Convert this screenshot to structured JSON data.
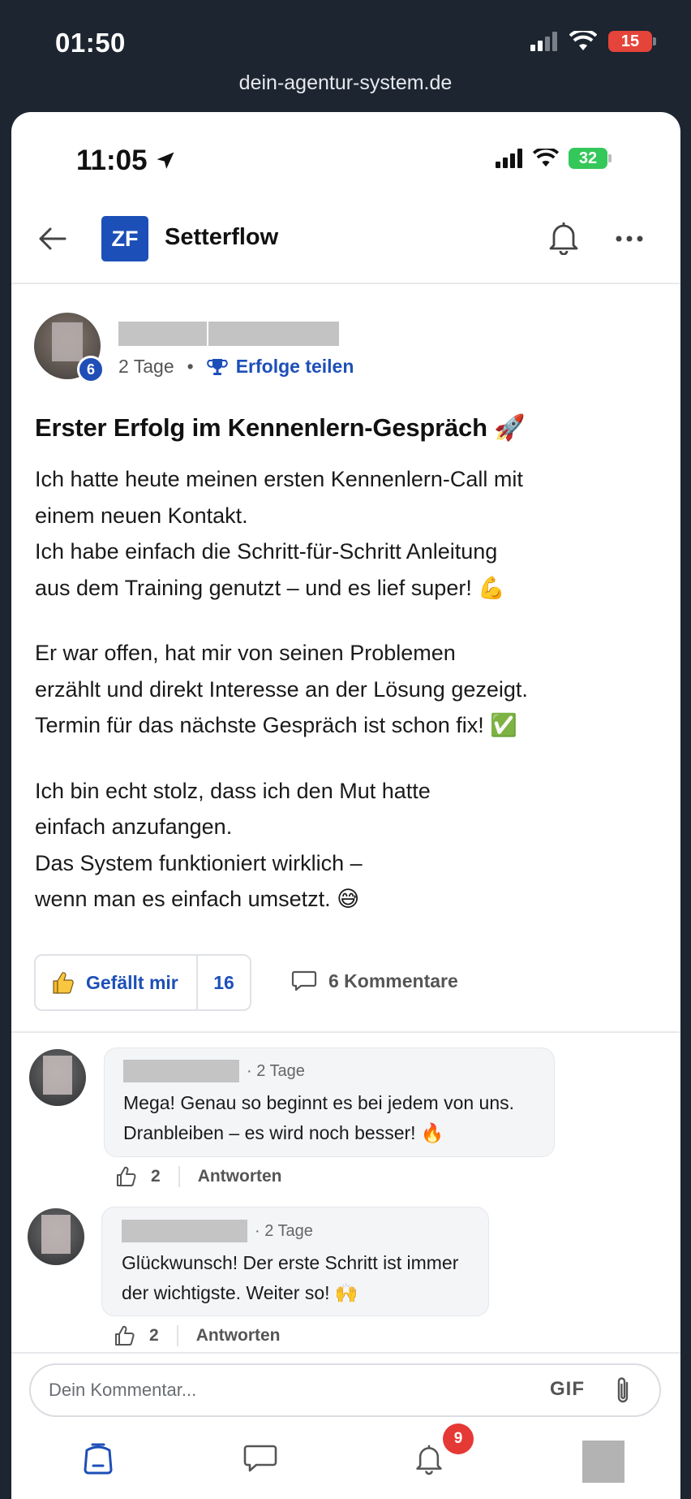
{
  "outer": {
    "time": "01:50",
    "battery": "15",
    "url": "dein-agentur-system.de"
  },
  "inner": {
    "time": "11:05",
    "battery": "32"
  },
  "app": {
    "logo_text": "ZF",
    "title": "Setterflow"
  },
  "post": {
    "author_level": "6",
    "time_ago": "2 Tage",
    "category": "Erfolge teilen",
    "title": "Erster Erfolg im Kennenlern-Gespräch 🚀",
    "paragraphs": [
      "Ich hatte heute meinen ersten Kennenlern-Call mit\neinem neuen Kontakt.\nIch habe einfach die Schritt-für-Schritt Anleitung\naus dem Training genutzt – und es lief super! 💪",
      "Er war offen, hat mir von seinen Problemen\nerzählt und direkt Interesse an der Lösung gezeigt.\nTermin für das nächste Gespräch ist schon fix! ✅",
      "Ich bin echt stolz, dass ich den Mut hatte\neinfach anzufangen.\nDas System funktioniert wirklich –\nwenn man es einfach umsetzt. 😅"
    ],
    "like_label": "Gefällt mir",
    "like_count": "16",
    "comments_label": "6 Kommentare"
  },
  "comments": [
    {
      "time": "· 2 Tage",
      "text": "Mega! Genau so beginnt es bei jedem von uns.\nDranbleiben – es wird noch besser! 🔥",
      "likes": "2",
      "reply_label": "Antworten"
    },
    {
      "time": "· 2 Tage",
      "text": "Glückwunsch! Der erste Schritt ist immer\nder wichtigste. Weiter so! 🙌",
      "likes": "2",
      "reply_label": "Antworten"
    }
  ],
  "composer": {
    "placeholder": "Dein Kommentar...",
    "gif_label": "GIF"
  },
  "nav": {
    "notification_count": "9"
  },
  "colors": {
    "brand": "#1d4fb8",
    "badge_red": "#e53935",
    "battery_green": "#34c759",
    "battery_red": "#e5443a"
  }
}
